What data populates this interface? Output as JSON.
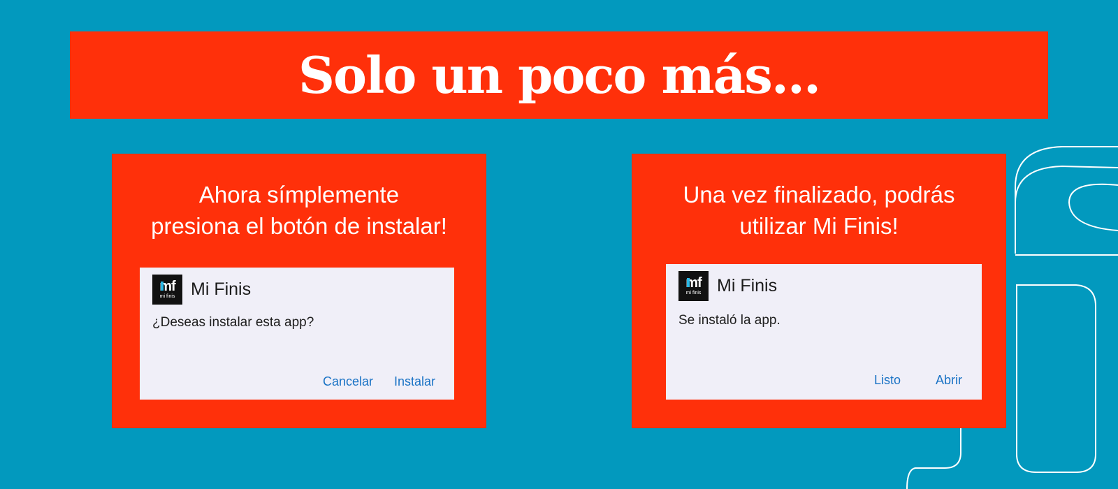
{
  "banner": {
    "title": "Solo un poco más..."
  },
  "step1": {
    "instruction_line1": "Ahora símplemente",
    "instruction_line2": "presiona el botón de instalar!",
    "dialog": {
      "logo_text": "mf",
      "logo_subtext": "mi finis",
      "app_name": "Mi Finis",
      "message": "¿Deseas instalar esta app?",
      "secondary_button": "Cancelar",
      "primary_button": "Instalar"
    }
  },
  "step2": {
    "instruction_line1": "Una vez finalizado, podrás",
    "instruction_line2": "utilizar Mi Finis!",
    "dialog": {
      "logo_text": "mf",
      "logo_subtext": "mi finis",
      "app_name": "Mi Finis",
      "message": "Se instaló la app.",
      "secondary_button": "Listo",
      "primary_button": "Abrir"
    }
  },
  "colors": {
    "background": "#0299be",
    "banner": "#ff300a",
    "button_text": "#1a73c5",
    "dialog_bg": "#f0eff8"
  }
}
